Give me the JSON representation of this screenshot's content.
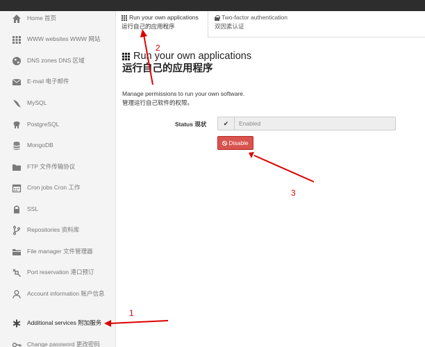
{
  "tabs": [
    {
      "label_en": "Run your own applications",
      "label_zh": "运行自己的应用程序"
    },
    {
      "label_en": "Two-factor authentication",
      "label_zh": "双因素认证"
    }
  ],
  "sidebar": {
    "items": [
      {
        "label": "Home 首页",
        "icon": "home-icon"
      },
      {
        "label": "WWW websites WWW 网站",
        "icon": "grid-icon"
      },
      {
        "label": "DNS zones DNS 区域",
        "icon": "globe-icon"
      },
      {
        "label": "E-mail 电子邮件",
        "icon": "envelope-icon"
      },
      {
        "label": "MySQL",
        "icon": "dolphin-icon"
      },
      {
        "label": "PostgreSQL",
        "icon": "elephant-icon"
      },
      {
        "label": "MongoDB",
        "icon": "database-icon"
      },
      {
        "label": "FTP 文件传输协议",
        "icon": "folder-icon"
      },
      {
        "label": "Cron jobs Cron 工作",
        "icon": "calendar-icon"
      },
      {
        "label": "SSL",
        "icon": "lock-icon"
      },
      {
        "label": "Repositories 资料库",
        "icon": "branch-icon"
      },
      {
        "label": "File manager 文件管理器",
        "icon": "file-folder-icon"
      },
      {
        "label": "Port reservation 港口预订",
        "icon": "plug-icon"
      },
      {
        "label": "Account information 账户信息",
        "icon": "user-icon"
      },
      {
        "label": "Additional services 附加服务",
        "icon": "asterisk-icon"
      },
      {
        "label": "Change password 更改密码",
        "icon": "key-icon"
      }
    ]
  },
  "main": {
    "title_en": "Run your own applications",
    "title_zh": "运行自己的应用程序",
    "description_en": "Manage permissions to run your own software.",
    "description_zh": "管理运行自己软件的权限。",
    "status_label": "Status 现状",
    "status_value": "Enabled",
    "disable_button": "Disable"
  },
  "annotations": {
    "a1": "1",
    "a2": "2",
    "a3": "3"
  },
  "colors": {
    "accent_red": "#d9534f",
    "annotation_red": "#d00000",
    "sidebar_bg": "#f4f4f4"
  }
}
